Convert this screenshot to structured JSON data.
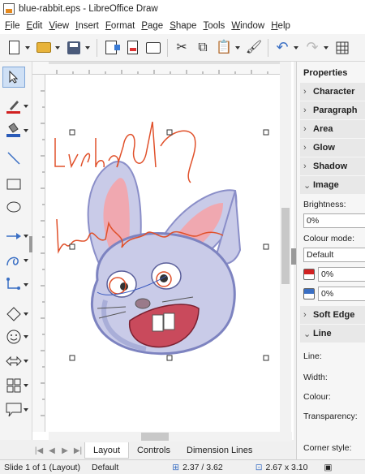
{
  "window": {
    "title": "blue-rabbit.eps - LibreOffice Draw"
  },
  "menu": [
    "File",
    "Edit",
    "View",
    "Insert",
    "Format",
    "Page",
    "Shape",
    "Tools",
    "Window",
    "Help"
  ],
  "tabs": [
    "Layout",
    "Controls",
    "Dimension Lines"
  ],
  "status": {
    "slide": "Slide 1 of 1 (Layout)",
    "master": "Default",
    "position": "2.37 / 3.62",
    "size": "2.67 x 3.10"
  },
  "sidebar": {
    "title": "Properties",
    "sections": [
      "Character",
      "Paragraph",
      "Area",
      "Glow",
      "Shadow",
      "Image",
      "Soft Edge",
      "Line"
    ],
    "image": {
      "brightness_label": "Brightness:",
      "brightness_value": "0%",
      "colour_mode_label": "Colour mode:",
      "colour_mode_value": "Default",
      "contrast_value": "0%",
      "transparency_value": "0%"
    },
    "line": {
      "line_label": "Line:",
      "width_label": "Width:",
      "colour_label": "Colour:",
      "transparency_label": "Transparency:",
      "corner_label": "Corner style:"
    }
  },
  "colors": {
    "accent": "#3a6fc4",
    "font_color": "#d12020",
    "fill_color": "#2a5bb8",
    "rabbit_body": "#c9cbe8",
    "ear_pink": "#f0a8b0",
    "annotation": "#e0502a"
  }
}
